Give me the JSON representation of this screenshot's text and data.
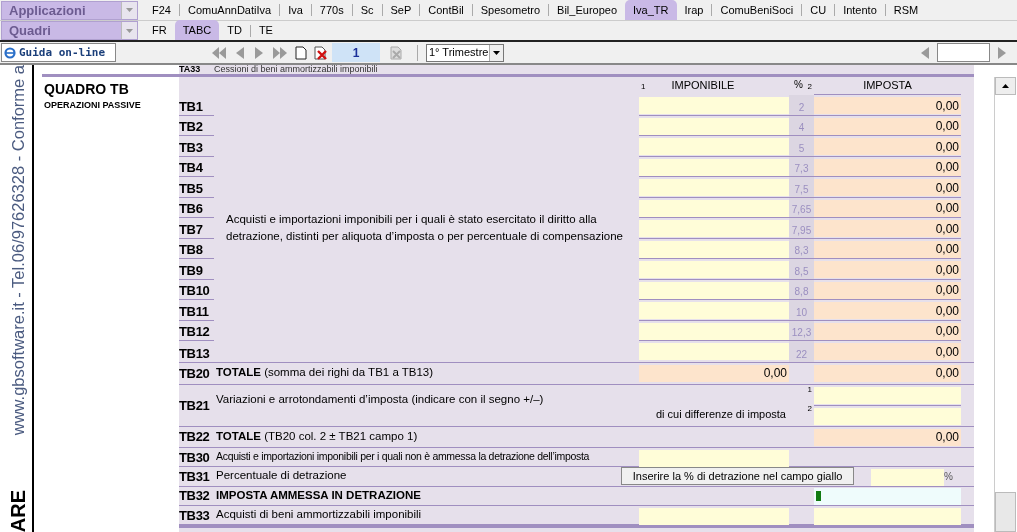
{
  "app_dropdown": {
    "value": "Applicazioni"
  },
  "menu_tabs": [
    {
      "label": "F24",
      "selected": false
    },
    {
      "label": "ComuAnnDatiIva",
      "selected": false
    },
    {
      "label": "Iva",
      "selected": false
    },
    {
      "label": "770s",
      "selected": false
    },
    {
      "label": "Sc",
      "selected": false
    },
    {
      "label": "SeP",
      "selected": false
    },
    {
      "label": "ContBil",
      "selected": false
    },
    {
      "label": "Spesometro",
      "selected": false
    },
    {
      "label": "Bil_Europeo",
      "selected": false
    },
    {
      "label": "Iva_TR",
      "selected": true
    },
    {
      "label": "Irap",
      "selected": false
    },
    {
      "label": "ComuBeniSoci",
      "selected": false
    },
    {
      "label": "CU",
      "selected": false
    },
    {
      "label": "Intento",
      "selected": false
    },
    {
      "label": "RSM",
      "selected": false
    }
  ],
  "quadri_dropdown": {
    "value": "Quadri"
  },
  "quadri_tabs": [
    {
      "label": "FR",
      "selected": false
    },
    {
      "label": "TABC",
      "selected": true
    },
    {
      "label": "TD",
      "selected": false
    },
    {
      "label": "TE",
      "selected": false
    }
  ],
  "toolbar": {
    "help_button": "Guida on-line",
    "page": "1",
    "period": "1° Trimestre"
  },
  "sidebar": {
    "vertical_text": "www.gbsoftware.it - Tel.06/97626328 - Conforme a",
    "brand_text": "ARE"
  },
  "form": {
    "prev_row": {
      "code": "TA33",
      "text": "Cessioni di beni ammortizzabili imponibili"
    },
    "title": "QUADRO TB",
    "subtitle": "OPERAZIONI PASSIVE",
    "header": {
      "col1_number": "1",
      "col1": "IMPONIBILE",
      "percent": "%",
      "col2_number": "2",
      "col2": "IMPOSTA"
    },
    "rate_description": "Acquisti e importazioni imponibili per i quali è stato esercitato il diritto alla detrazione, distinti per aliquota d’imposta o per percentuale di compensazione",
    "rate_rows": [
      {
        "code": "TB1",
        "percent": "2",
        "imposta": "0,00"
      },
      {
        "code": "TB2",
        "percent": "4",
        "imposta": "0,00"
      },
      {
        "code": "TB3",
        "percent": "5",
        "imposta": "0,00"
      },
      {
        "code": "TB4",
        "percent": "7,3",
        "imposta": "0,00"
      },
      {
        "code": "TB5",
        "percent": "7,5",
        "imposta": "0,00"
      },
      {
        "code": "TB6",
        "percent": "7,65",
        "imposta": "0,00"
      },
      {
        "code": "TB7",
        "percent": "7,95",
        "imposta": "0,00"
      },
      {
        "code": "TB8",
        "percent": "8,3",
        "imposta": "0,00"
      },
      {
        "code": "TB9",
        "percent": "8,5",
        "imposta": "0,00"
      },
      {
        "code": "TB10",
        "percent": "8,8",
        "imposta": "0,00"
      },
      {
        "code": "TB11",
        "percent": "10",
        "imposta": "0,00"
      },
      {
        "code": "TB12",
        "percent": "12,3",
        "imposta": "0,00"
      },
      {
        "code": "TB13",
        "percent": "22",
        "imposta": "0,00"
      }
    ],
    "total_rows": [
      {
        "kind": "total",
        "code": "TB20",
        "text": "**TOTALE** (somma dei righi da TB1 a TB13)",
        "imponibile": "0,00",
        "imposta": "0,00"
      },
      {
        "kind": "variation",
        "code": "TB21",
        "text": "Variazioni e arrotondamenti d’imposta (indicare con il segno +/–)",
        "sub_text": "di cui differenze di imposta",
        "field_numbers": [
          "1",
          "2"
        ]
      },
      {
        "kind": "grand_total",
        "code": "TB22",
        "text": "**TOTALE** (TB20 col. 2 ± TB21 campo 1)",
        "imposta": "0,00"
      },
      {
        "kind": "non_deductible",
        "code": "TB30",
        "text": "Acquisti e importazioni imponibili per i quali non è ammessa la detrazione dell’imposta"
      },
      {
        "kind": "percentage",
        "code": "TB31",
        "text": "Percentuale di detrazione",
        "button": "Inserire la % di detrazione nel campo giallo",
        "unit": "%"
      },
      {
        "kind": "deductible",
        "code": "TB32",
        "text": "IMPOSTA AMMESSA IN DETRAZIONE"
      },
      {
        "kind": "assets",
        "code": "TB33",
        "text": "Acquisti di beni ammortizzabili imponibili"
      }
    ]
  }
}
